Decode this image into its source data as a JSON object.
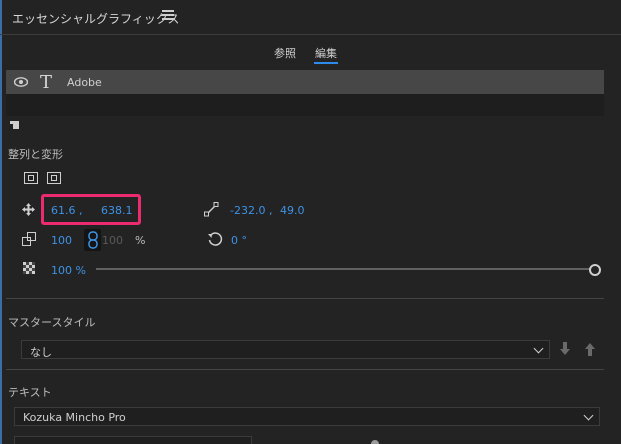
{
  "panel": {
    "title": "エッセンシャルグラフィックス"
  },
  "tabs": [
    {
      "label": "参照"
    },
    {
      "label": "編集",
      "active": true
    }
  ],
  "layer": {
    "name": "Adobe"
  },
  "align_section": {
    "title": "整列と変形"
  },
  "transform": {
    "position_x": "61.6 ,",
    "position_y": "638.1",
    "anchor_x": "-232.0 ,",
    "anchor_y": "49.0",
    "scale_w": "100",
    "scale_h": "100",
    "scale_unit": "%",
    "rotation": "0 °",
    "opacity": "100 %"
  },
  "master_style": {
    "title": "マスタースタイル",
    "selected": "なし"
  },
  "text_section": {
    "title": "テキスト",
    "font": "Kozuka Mincho Pro"
  },
  "colors": {
    "accent": "#3d93e6",
    "highlight": "#ec2a6f",
    "background": "#232323"
  }
}
